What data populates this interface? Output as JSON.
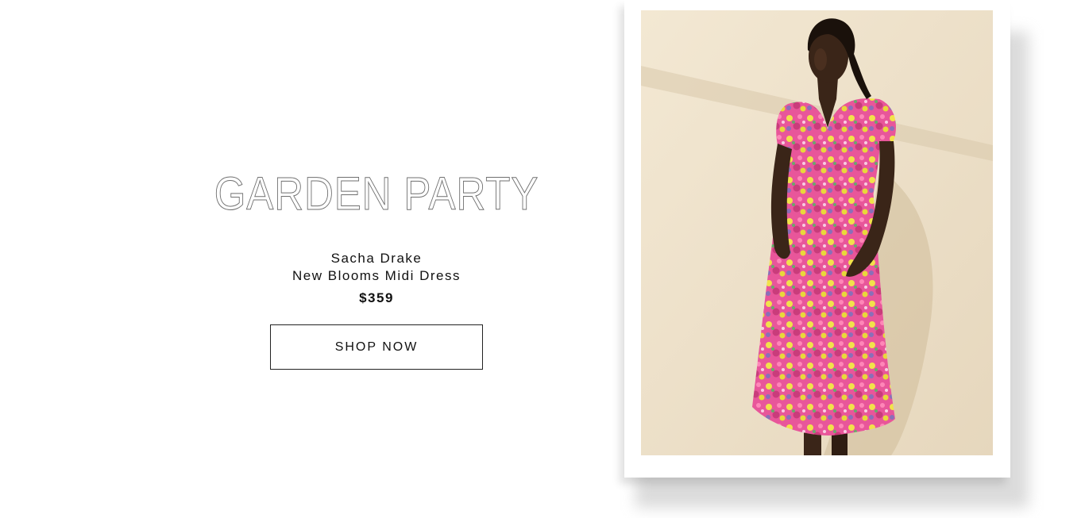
{
  "headline": "GARDEN PARTY",
  "product": {
    "brand": "Sacha Drake",
    "name": "New Blooms Midi Dress",
    "price": "$359"
  },
  "cta": {
    "label": "SHOP NOW"
  },
  "image": {
    "alt": "Model wearing floral midi dress",
    "colors": {
      "wall": "#efe3cc",
      "dress_pink": "#e8569a",
      "dress_yellow": "#e9d83a",
      "dress_purple": "#8a6fb8",
      "skin": "#3a2518"
    }
  }
}
